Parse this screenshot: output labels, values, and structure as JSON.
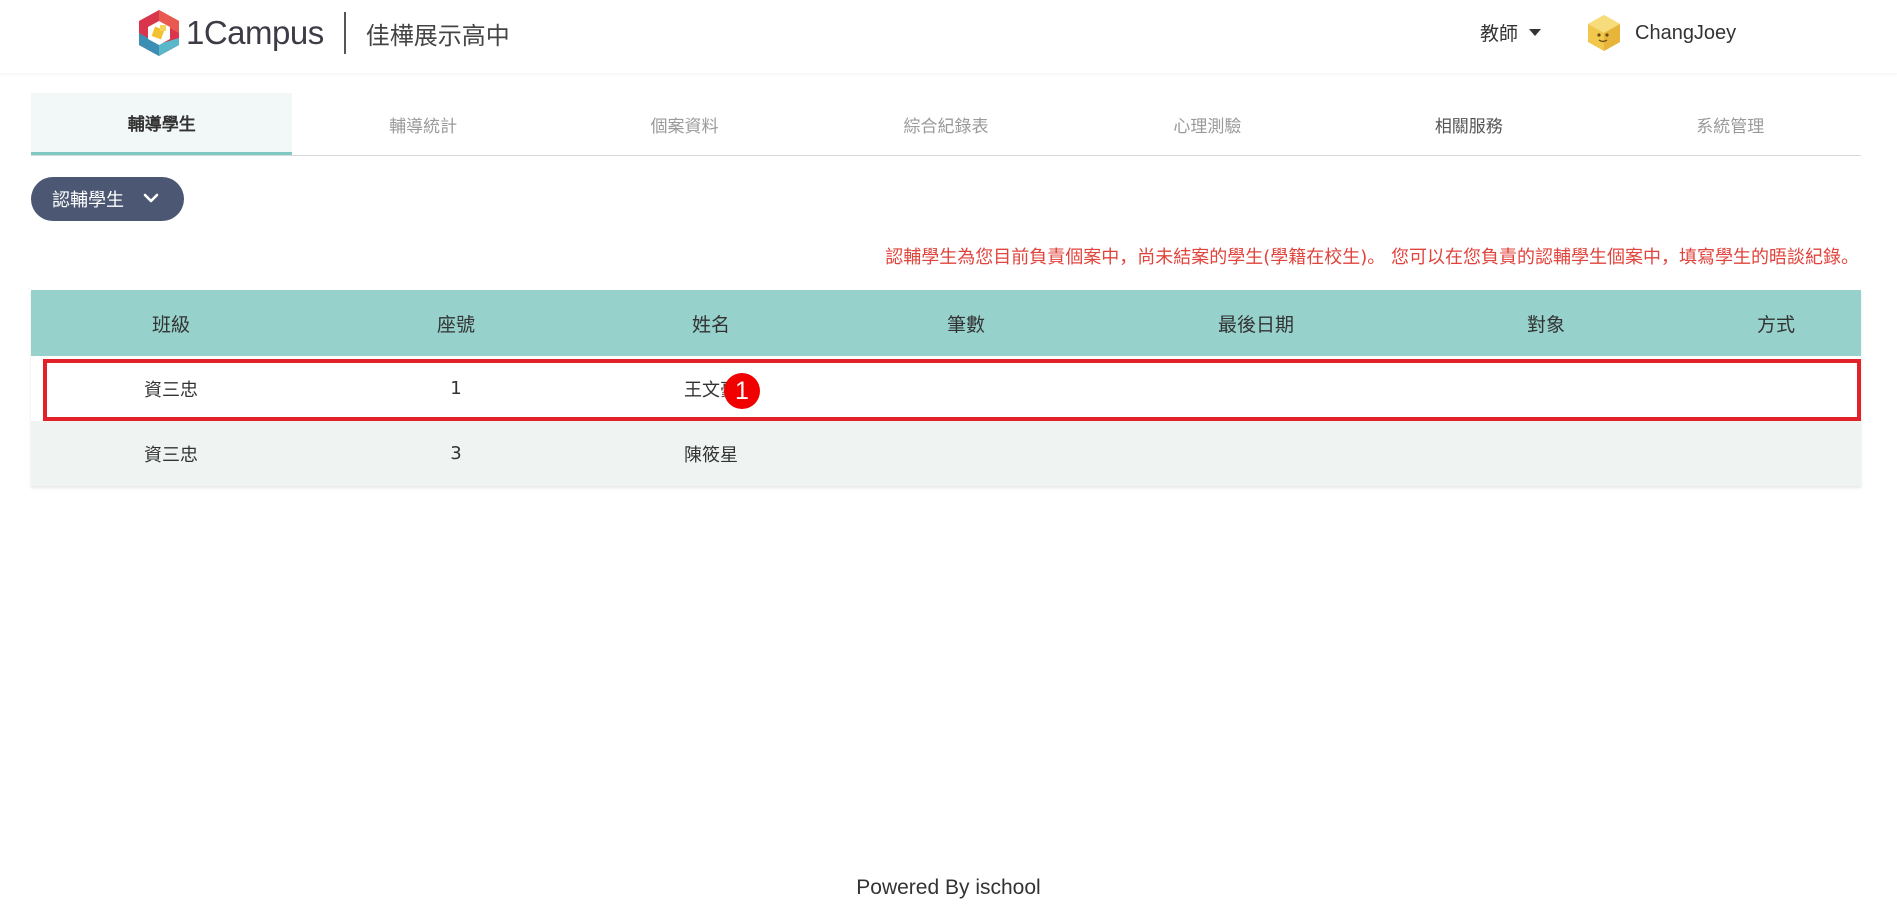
{
  "header": {
    "logo_text": "1Campus",
    "school_name": "佳樺展示高中",
    "role": "教師",
    "user_name": "ChangJoey"
  },
  "tabs": [
    {
      "label": "輔導學生",
      "active": true
    },
    {
      "label": "輔導統計",
      "active": false
    },
    {
      "label": "個案資料",
      "active": false
    },
    {
      "label": "綜合紀錄表",
      "active": false
    },
    {
      "label": "心理測驗",
      "active": false
    },
    {
      "label": "相關服務",
      "active": false
    },
    {
      "label": "系統管理",
      "active": false
    }
  ],
  "filter": {
    "label": "認輔學生"
  },
  "note": "認輔學生為您目前負責個案中，尚未結案的學生(學籍在校生)。 您可以在您負責的認輔學生個案中，填寫學生的晤談紀錄。",
  "table": {
    "columns": [
      "班級",
      "座號",
      "姓名",
      "筆數",
      "最後日期",
      "對象",
      "方式"
    ],
    "rows": [
      {
        "class": "資三忠",
        "seat": "1",
        "name": "王文豪",
        "count": "",
        "last_date": "",
        "target": "",
        "method": ""
      },
      {
        "class": "資三忠",
        "seat": "3",
        "name": "陳筱星",
        "count": "",
        "last_date": "",
        "target": "",
        "method": ""
      }
    ]
  },
  "annotation_marker": "1",
  "colors": {
    "accent": "#96d1cb",
    "button": "#4c5873",
    "note": "#e0443c",
    "highlight": "#e3212b"
  },
  "footer": "Powered By ischool"
}
